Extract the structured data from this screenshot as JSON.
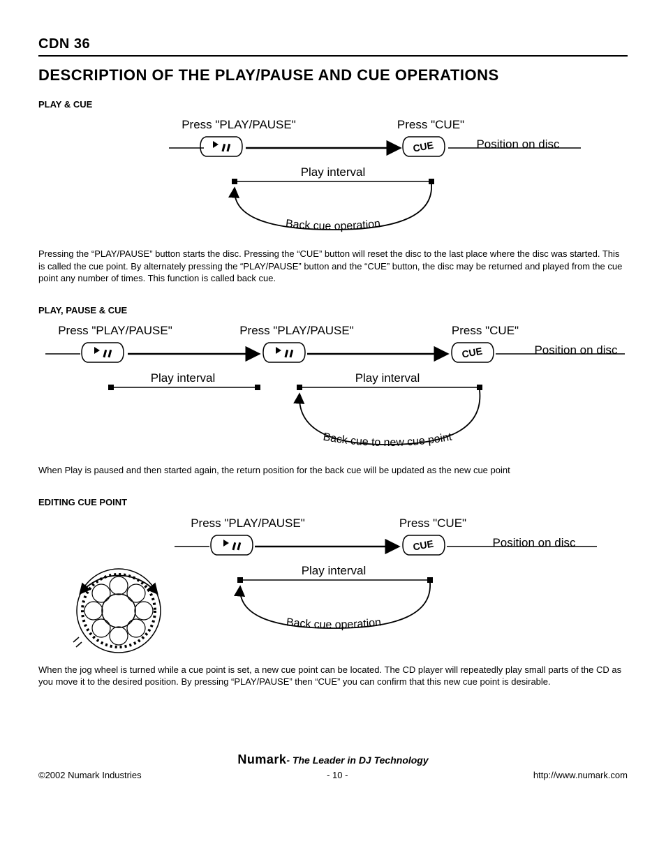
{
  "header": {
    "model": "CDN 36"
  },
  "title": "DESCRIPTION OF THE PLAY/PAUSE AND CUE OPERATIONS",
  "sections": {
    "play_cue": {
      "heading": "PLAY & CUE",
      "diagram": {
        "press_play": "Press \"PLAY/PAUSE\"",
        "press_cue": "Press \"CUE\"",
        "position": "Position on disc",
        "play_interval": "Play interval",
        "back_cue": "Back cue operation",
        "cue_btn": "CUE"
      },
      "body": "Pressing the “PLAY/PAUSE” button starts the disc. Pressing the “CUE” button will reset the disc to the last place where the disc was started.  This is called the cue point.  By alternately pressing the “PLAY/PAUSE” button and the “CUE” button, the disc may be returned and played from the cue point any number of times.  This function is called back cue."
    },
    "play_pause_cue": {
      "heading": "PLAY, PAUSE & CUE",
      "diagram": {
        "press_play": "Press \"PLAY/PAUSE\"",
        "press_cue": "Press \"CUE\"",
        "position": "Position on disc",
        "play_interval": "Play interval",
        "back_cue": "Back cue to new cue point",
        "cue_btn": "CUE"
      },
      "body": "When Play is paused and then started again, the return position for the back cue will be updated as the new cue point"
    },
    "editing_cue": {
      "heading": "EDITING CUE POINT",
      "diagram": {
        "press_play": "Press \"PLAY/PAUSE\"",
        "press_cue": "Press \"CUE\"",
        "position": "Position on disc",
        "play_interval": "Play interval",
        "back_cue": "Back cue operation",
        "cue_btn": "CUE"
      },
      "body": "When the jog wheel is turned while a cue point is set, a new cue point can be located.  The CD player will repeatedly play small parts of the CD as you move it to the desired position.  By pressing “PLAY/PAUSE” then “CUE” you can confirm that this new cue point is desirable."
    }
  },
  "footer": {
    "brand": "Numark",
    "tagline": "- The Leader in DJ Technology",
    "copyright": "©2002 Numark Industries",
    "page": "- 10 -",
    "url": "http://www.numark.com"
  }
}
